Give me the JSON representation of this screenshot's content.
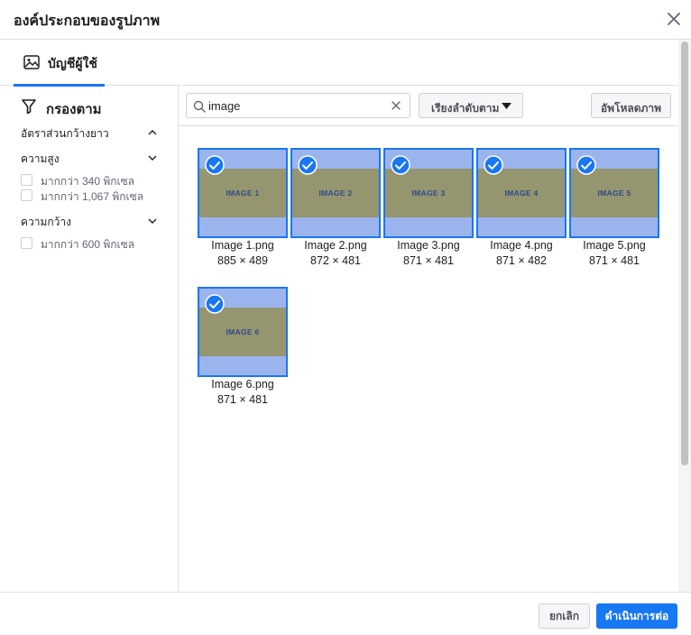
{
  "dialog": {
    "title": "องค์ประกอบของรูปภาพ"
  },
  "tabs": [
    {
      "label": "บัญชีผู้ใช้",
      "icon": "image-icon",
      "active": true
    }
  ],
  "filters": {
    "heading": "กรองตาม",
    "sections": [
      {
        "title": "อัตราส่วนกว้างยาว",
        "expanded": false,
        "options": []
      },
      {
        "title": "ความสูง",
        "expanded": true,
        "options": [
          "มากกว่า 340 พิกเซล",
          "มากกว่า 1,067 พิกเซล"
        ]
      },
      {
        "title": "ความกว้าง",
        "expanded": true,
        "options": [
          "มากกว่า 600 พิกเซล"
        ]
      }
    ]
  },
  "toolbar": {
    "search_value": "image",
    "sort_label": "เรียงลำดับตาม",
    "upload_label": "อัพโหลดภาพ"
  },
  "images": [
    {
      "label": "IMAGE 1",
      "name": "Image 1.png",
      "dims": "885 × 489",
      "selected": true
    },
    {
      "label": "IMAGE 2",
      "name": "Image 2.png",
      "dims": "872 × 481",
      "selected": true
    },
    {
      "label": "IMAGE 3",
      "name": "Image 3.png",
      "dims": "871 × 481",
      "selected": true
    },
    {
      "label": "IMAGE 4",
      "name": "Image 4.png",
      "dims": "871 × 482",
      "selected": true
    },
    {
      "label": "IMAGE 5",
      "name": "Image 5.png",
      "dims": "871 × 481",
      "selected": true
    },
    {
      "label": "IMAGE 6",
      "name": "Image 6.png",
      "dims": "871 × 481",
      "selected": true
    }
  ],
  "footer": {
    "cancel_label": "ยกเลิก",
    "continue_label": "ดำเนินการต่อ"
  },
  "colors": {
    "accent": "#1877f2",
    "thumb_bg": "#9cb4ee",
    "thumb_band": "#95966f"
  }
}
